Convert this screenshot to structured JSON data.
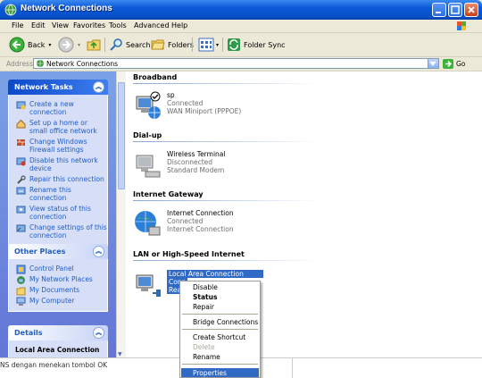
{
  "window": {
    "title": "Network Connections"
  },
  "menu": [
    "File",
    "Edit",
    "View",
    "Favorites",
    "Tools",
    "Advanced",
    "Help"
  ],
  "toolbar": {
    "back": "Back",
    "search": "Search",
    "folders": "Folders",
    "folder_sync": "Folder Sync"
  },
  "address": {
    "label": "Address",
    "value": "Network Connections",
    "go": "Go"
  },
  "left": {
    "network_tasks": {
      "title": "Network Tasks",
      "items": [
        "Create a new connection",
        "Set up a home or small office network",
        "Change Windows Firewall settings",
        "Disable this network device",
        "Repair this connection",
        "Rename this connection",
        "View status of this connection",
        "Change settings of this connection"
      ]
    },
    "other_places": {
      "title": "Other Places",
      "items": [
        "Control Panel",
        "My Network Places",
        "My Documents",
        "My Computer"
      ]
    },
    "details": {
      "title": "Details",
      "subtitle": "Local Area Connection"
    }
  },
  "groups": {
    "broadband": "Broadband",
    "dialup": "Dial-up",
    "gateway": "Internet Gateway",
    "lan": "LAN or High-Speed Internet"
  },
  "connections": {
    "sp": {
      "name": "sp",
      "status": "Connected",
      "device": "WAN Miniport (PPPOE)"
    },
    "wireless": {
      "name": "Wireless Terminal",
      "status": "Disconnected",
      "device": "Standard Modem"
    },
    "internet": {
      "name": "Internet Connection",
      "status": "Connected",
      "device": "Internet Connection"
    },
    "lan": {
      "name": "Local Area Connection",
      "status": "Conn",
      "device": "Real"
    }
  },
  "context_menu": {
    "disable": "Disable",
    "status": "Status",
    "repair": "Repair",
    "bridge": "Bridge Connections",
    "shortcut": "Create Shortcut",
    "delete": "Delete",
    "rename": "Rename",
    "properties": "Properties"
  },
  "footer": {
    "text": "NS dengan menekan tombol OK"
  },
  "colors": {
    "titlebar": "#0a58d8",
    "task_link": "#215dc6",
    "selection": "#316ac5"
  }
}
